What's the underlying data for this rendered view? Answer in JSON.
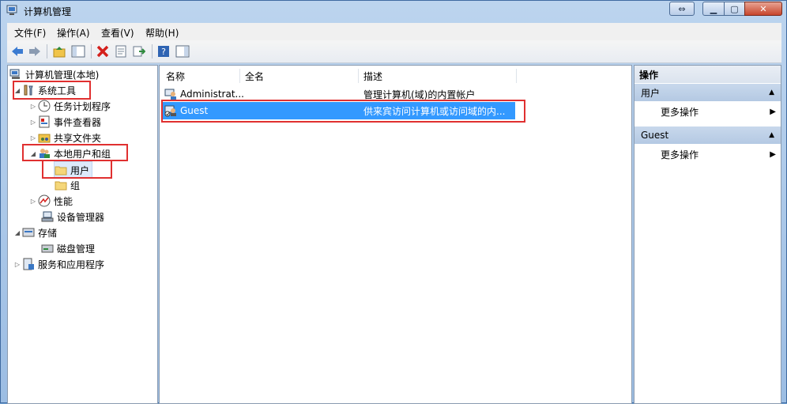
{
  "window": {
    "title": "计算机管理"
  },
  "menu": [
    "文件(F)",
    "操作(A)",
    "查看(V)",
    "帮助(H)"
  ],
  "tree": [
    {
      "label": "计算机管理(本地)",
      "icon": "computer-mgmt-icon"
    },
    {
      "label": "系统工具",
      "icon": "tools-icon"
    },
    {
      "label": "任务计划程序",
      "icon": "clock-icon"
    },
    {
      "label": "事件查看器",
      "icon": "event-viewer-icon"
    },
    {
      "label": "共享文件夹",
      "icon": "shared-folder-icon"
    },
    {
      "label": "本地用户和组",
      "icon": "users-group-icon"
    },
    {
      "label": "用户",
      "icon": "folder-icon"
    },
    {
      "label": "组",
      "icon": "folder-icon"
    },
    {
      "label": "性能",
      "icon": "performance-icon"
    },
    {
      "label": "设备管理器",
      "icon": "device-manager-icon"
    },
    {
      "label": "存储",
      "icon": "storage-icon"
    },
    {
      "label": "磁盘管理",
      "icon": "disk-icon"
    },
    {
      "label": "服务和应用程序",
      "icon": "services-icon"
    }
  ],
  "columns": [
    "名称",
    "全名",
    "描述"
  ],
  "users": [
    {
      "name": "Administrat...",
      "fullname": "",
      "desc": "管理计算机(域)的内置帐户"
    },
    {
      "name": "Guest",
      "fullname": "",
      "desc": "供来宾访问计算机或访问域的内..."
    }
  ],
  "actions": {
    "title": "操作",
    "sections": [
      {
        "header": "用户",
        "item": "更多操作"
      },
      {
        "header": "Guest",
        "item": "更多操作"
      }
    ]
  }
}
